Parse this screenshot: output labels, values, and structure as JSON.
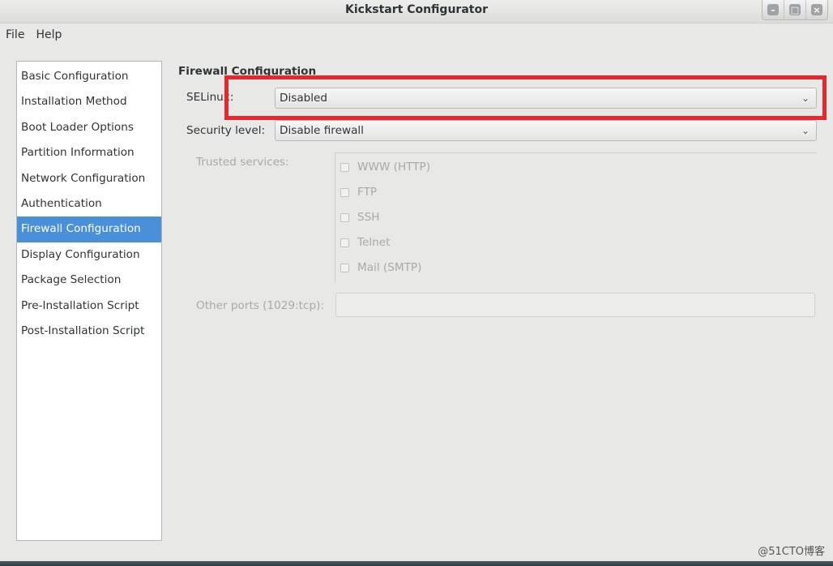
{
  "window": {
    "title": "Kickstart Configurator",
    "controls": [
      "minimize-icon",
      "maximize-icon",
      "close-icon"
    ]
  },
  "menubar": {
    "items": [
      "File",
      "Help"
    ]
  },
  "sidebar": {
    "selected_index": 6,
    "items": [
      "Basic Configuration",
      "Installation Method",
      "Boot Loader Options",
      "Partition Information",
      "Network Configuration",
      "Authentication",
      "Firewall Configuration",
      "Display Configuration",
      "Package Selection",
      "Pre-Installation Script",
      "Post-Installation Script"
    ]
  },
  "firewall": {
    "section_title": "Firewall Configuration",
    "selinux": {
      "label": "SELinux:",
      "value": "Disabled"
    },
    "security_level": {
      "label": "Security level:",
      "value": "Disable firewall"
    },
    "trusted_services": {
      "label": "Trusted services:",
      "items": [
        "WWW (HTTP)",
        "FTP",
        "SSH",
        "Telnet",
        "Mail (SMTP)"
      ]
    },
    "other_ports": {
      "label": "Other ports (1029:tcp):",
      "value": ""
    }
  },
  "annotation": {
    "highlight_color": "#e8262b"
  },
  "colors": {
    "selection": "#4a90d9"
  },
  "watermark": "@51CTO博客"
}
